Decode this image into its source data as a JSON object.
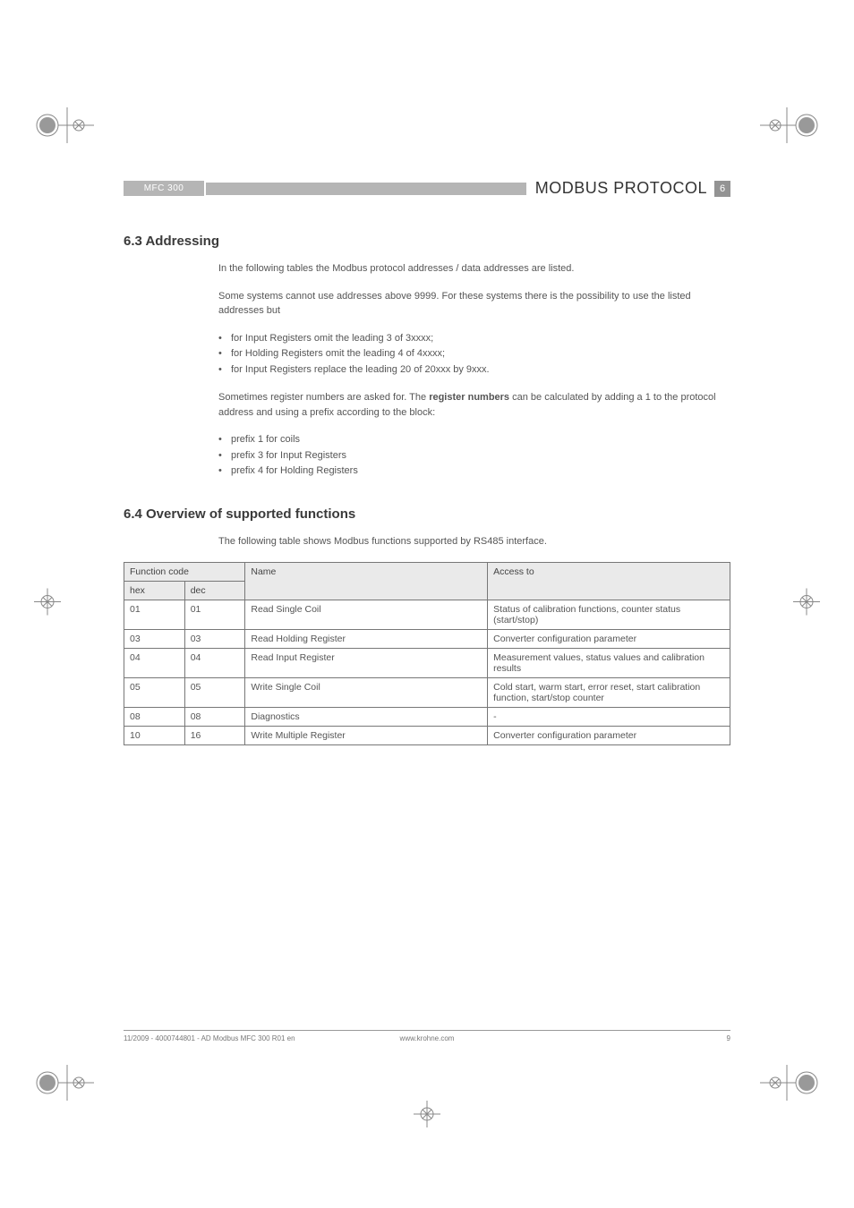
{
  "header": {
    "left_tag": "MFC 300",
    "title": "MODBUS PROTOCOL",
    "badge": "6"
  },
  "section_63": {
    "heading": "6.3  Addressing",
    "p1": "In the following tables the Modbus protocol addresses / data addresses are listed.",
    "p2": "Some systems cannot use addresses above 9999. For these systems there is the possibility to use the listed addresses but",
    "bullets1": [
      "for Input Registers omit the leading 3 of 3xxxx;",
      "for Holding Registers omit the leading 4 of 4xxxx;",
      "for Input Registers replace the leading 20 of 20xxx by 9xxx."
    ],
    "p3a": "Sometimes register numbers are asked for. The ",
    "p3b": "register numbers",
    "p3c": " can be calculated by adding a 1 to the protocol address and using a prefix according to the block:",
    "bullets2": [
      "prefix 1 for coils",
      "prefix 3 for Input Registers",
      "prefix 4 for Holding Registers"
    ]
  },
  "section_64": {
    "heading": "6.4  Overview of supported functions",
    "intro": "The following table shows Modbus functions supported by RS485 interface.",
    "table": {
      "h_func": "Function code",
      "h_name": "Name",
      "h_access": "Access to",
      "h_hex": "hex",
      "h_dec": "dec",
      "rows": [
        {
          "hex": "01",
          "dec": "01",
          "name": "Read Single Coil",
          "access": "Status of calibration functions, counter status (start/stop)"
        },
        {
          "hex": "03",
          "dec": "03",
          "name": "Read Holding Register",
          "access": "Converter configuration parameter"
        },
        {
          "hex": "04",
          "dec": "04",
          "name": "Read Input Register",
          "access": "Measurement values,  status values and calibration results"
        },
        {
          "hex": "05",
          "dec": "05",
          "name": "Write Single Coil",
          "access": "Cold start, warm start, error reset, start calibration function, start/stop counter"
        },
        {
          "hex": "08",
          "dec": "08",
          "name": "Diagnostics",
          "access": "-"
        },
        {
          "hex": "10",
          "dec": "16",
          "name": "Write  Multiple Register",
          "access": "Converter configuration parameter"
        }
      ]
    }
  },
  "footer": {
    "left": "11/2009 - 4000744801 - AD Modbus MFC 300 R01 en",
    "center": "www.krohne.com",
    "right": "9"
  }
}
